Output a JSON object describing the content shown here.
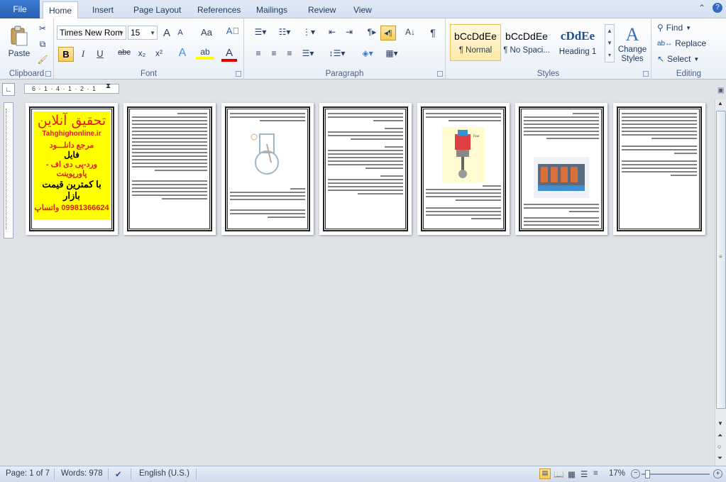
{
  "tabs": {
    "file": "File",
    "items": [
      "Home",
      "Insert",
      "Page Layout",
      "References",
      "Mailings",
      "Review",
      "View"
    ],
    "active": "Home"
  },
  "ribbon": {
    "clipboard": {
      "label": "Clipboard",
      "paste": "Paste"
    },
    "font": {
      "label": "Font",
      "name": "Times New Rom",
      "size": "15",
      "bold": "B",
      "italic": "I",
      "underline": "U",
      "strike": "abc",
      "sub": "x₂",
      "sup": "x²",
      "grow": "A",
      "shrink": "A",
      "case": "Aa"
    },
    "paragraph": {
      "label": "Paragraph"
    },
    "styles": {
      "label": "Styles",
      "items": [
        {
          "sample": "bCcDdEe",
          "name": "¶ Normal"
        },
        {
          "sample": "bCcDdEe",
          "name": "¶ No Spaci..."
        },
        {
          "sample": "cDdEe",
          "name": "Heading 1"
        }
      ],
      "change": "Change Styles"
    },
    "editing": {
      "label": "Editing",
      "find": "Find",
      "replace": "Replace",
      "select": "Select"
    }
  },
  "ruler": {
    "ticks": "6 · 1 · 4 · 1 · 2 · 1"
  },
  "ad": {
    "title": "تحقیق آنلاین",
    "site": "Tahghighonline.ir",
    "line1": "مرجع دانلـــود",
    "line2": "فایل",
    "line3": "ورد-پی دی اف - پاورپوینت",
    "line4": "با کمترین قیمت بازار",
    "phone": "09981366624 واتساپ"
  },
  "status": {
    "page": "Page: 1 of 7",
    "words": "Words: 978",
    "language": "English (U.S.)",
    "zoom": "17%"
  },
  "colors": {
    "file_tab": "#2a5fb0",
    "ad_background": "#ffff00",
    "ad_red": "#e21c1c"
  }
}
